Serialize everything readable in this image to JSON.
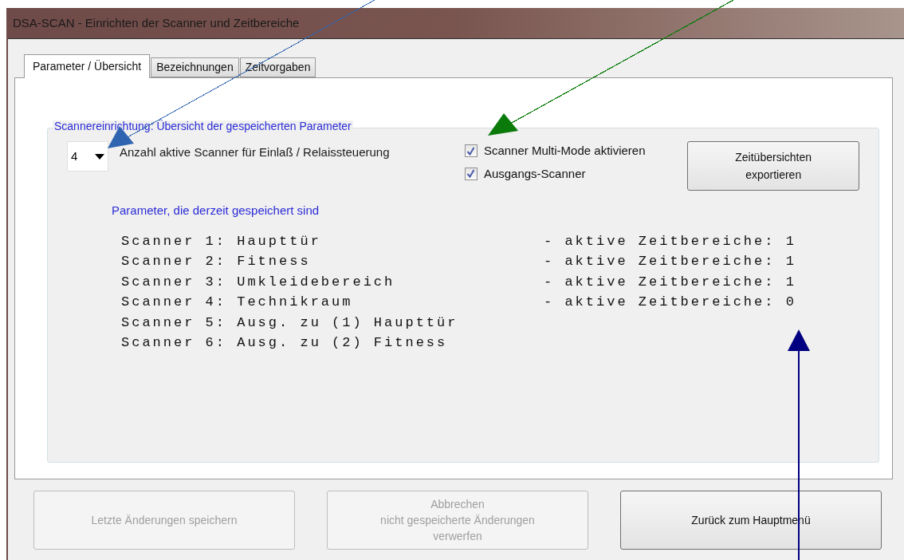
{
  "window": {
    "title": "DSA-SCAN - Einrichten der Scanner und Zeitbereiche"
  },
  "tabs": [
    {
      "label": "Parameter / Übersicht",
      "selected": true
    },
    {
      "label": "Bezeichnungen",
      "selected": false
    },
    {
      "label": "Zeitvorgaben",
      "selected": false
    }
  ],
  "group": {
    "title": "Scannereinrichtung: Übersicht der gespeicherten Parameter",
    "scanner_count": {
      "value": "4",
      "label": "Anzahl aktive Scanner für Einlaß / Relaissteuerung"
    },
    "checkboxes": [
      {
        "label": "Scanner Multi-Mode aktivieren",
        "checked": true
      },
      {
        "label": "Ausgangs-Scanner",
        "checked": true
      }
    ],
    "export_button": "Zeitübersichten exportieren",
    "saved_heading": "Parameter, die derzeit gespeichert sind",
    "scanners": [
      {
        "name": "Scanner 1: Haupttür",
        "zeitbereiche": "- aktive Zeitbereiche: 1"
      },
      {
        "name": "Scanner 2: Fitness",
        "zeitbereiche": "- aktive Zeitbereiche: 1"
      },
      {
        "name": "Scanner 3: Umkleidebereich",
        "zeitbereiche": "- aktive Zeitbereiche: 1"
      },
      {
        "name": "Scanner 4: Technikraum",
        "zeitbereiche": "- aktive Zeitbereiche: 0"
      },
      {
        "name": "Scanner 5: Ausg. zu (1) Haupttür"
      },
      {
        "name": "Scanner 6: Ausg. zu (2) Fitness"
      }
    ]
  },
  "buttons": [
    {
      "lines": [
        "Letzte Änderungen speichern"
      ],
      "disabled": true
    },
    {
      "lines": [
        "Abbrechen",
        "nicht gespeicherte Änderungen",
        "verwerfen"
      ],
      "disabled": true
    },
    {
      "lines": [
        "Zurück zum Hauptmenü"
      ],
      "disabled": false
    }
  ],
  "annotations": [
    {
      "kind": "arrow",
      "color": "#2f65b0"
    },
    {
      "kind": "arrow",
      "color": "#0a7a0a"
    },
    {
      "kind": "arrow",
      "color": "#000080"
    }
  ]
}
